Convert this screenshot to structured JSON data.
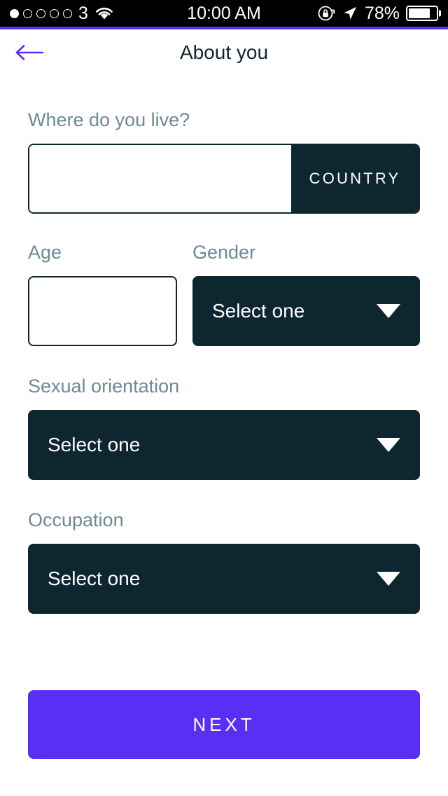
{
  "status_bar": {
    "signal_dots_total": 5,
    "signal_dots_filled": 1,
    "carrier": "3",
    "wifi_icon": "wifi-icon",
    "time": "10:00 AM",
    "rotation_lock_icon": "rotation-lock-icon",
    "location_icon": "location-arrow-icon",
    "battery_percent": "78%",
    "battery_level": 78
  },
  "nav": {
    "back_icon": "arrow-left-icon",
    "title": "About you"
  },
  "form": {
    "country": {
      "label": "Where do you live?",
      "input_value": "",
      "input_placeholder": "",
      "button_label": "COUNTRY"
    },
    "age": {
      "label": "Age",
      "input_value": "",
      "input_placeholder": ""
    },
    "gender": {
      "label": "Gender",
      "value": "Select one",
      "caret_icon": "chevron-down-icon"
    },
    "sexual_orientation": {
      "label": "Sexual orientation",
      "value": "Select one",
      "caret_icon": "chevron-down-icon"
    },
    "occupation": {
      "label": "Occupation",
      "value": "Select one",
      "caret_icon": "chevron-down-icon"
    }
  },
  "footer": {
    "next_label": "NEXT"
  },
  "colors": {
    "accent_purple": "#5a2ef5",
    "dark_navy": "#0d2630",
    "label_gray": "#6d8a93",
    "title_navy": "#11242e",
    "background": "#ffffff",
    "status_bar_bg": "#000000"
  }
}
